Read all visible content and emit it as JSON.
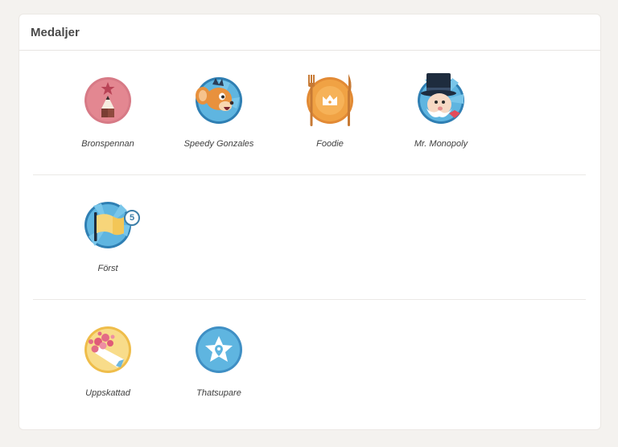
{
  "panel": {
    "title": "Medaljer"
  },
  "medals": [
    {
      "name": "Bronspennan",
      "icon": "bronze-pen-icon"
    },
    {
      "name": "Speedy Gonzales",
      "icon": "speedy-gonzales-icon"
    },
    {
      "name": "Foodie",
      "icon": "foodie-plate-icon"
    },
    {
      "name": "Mr. Monopoly",
      "icon": "mr-monopoly-icon"
    },
    {
      "name": "Först",
      "icon": "flag-icon",
      "count": "5"
    },
    {
      "name": "Uppskattad",
      "icon": "bouquet-icon"
    },
    {
      "name": "Thatsupare",
      "icon": "star-pin-icon"
    }
  ],
  "colors": {
    "background": "#f4f2ef",
    "card": "#ffffff",
    "badge_border": "#3d7fa9"
  }
}
